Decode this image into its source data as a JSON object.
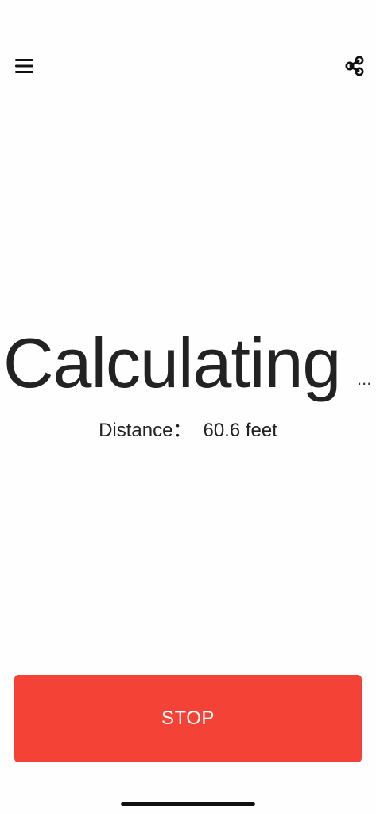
{
  "header": {
    "menu_icon": "hamburger-menu-icon",
    "share_icon": "share-icon"
  },
  "status": {
    "text": "Calculating",
    "ellipsis": "..."
  },
  "distance": {
    "label": "Distance：",
    "value": "60.6 feet"
  },
  "stop_button": {
    "label": "STOP",
    "color": "#f44336"
  }
}
